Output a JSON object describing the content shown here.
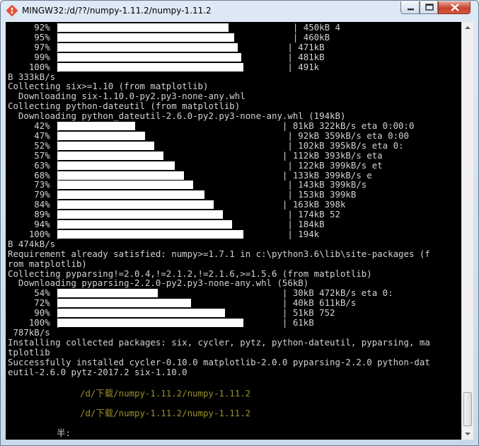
{
  "window": {
    "title": "MINGW32:/d/??/numpy-1.11.2/numpy-1.11.2"
  },
  "terminal": {
    "lines": [
      "     92% |                                            | 450kB 4",
      "     95% |                                            | 460kB",
      "     97% |                                           | 471kB",
      "     99% |                                           | 481kB",
      "    100% |                                           | 491k",
      "B 333kB/s",
      "Collecting six>=1.10 (from matplotlib)",
      "  Downloading six-1.10.0-py2.py3-none-any.whl",
      "Collecting python-dateutil (from matplotlib)",
      "  Downloading python_dateutil-2.6.0-py2.py3-none-any.whl (194kB)",
      "     42% |                                          | 81kB 322kB/s eta 0:00:0",
      "     47% |                                           | 92kB 359kB/s eta 0:00",
      "     52% |                                           | 102kB 395kB/s eta 0:",
      "     57% |                                          | 112kB 393kB/s eta",
      "     63% |                                           | 122kB 399kB/s et",
      "     68% |                                          | 133kB 399kB/s e",
      "     73% |                                           | 143kB 399kB/s",
      "     79% |                                           | 153kB 399kB",
      "     84% |                                          | 163kB 398k",
      "     89% |                                           | 174kB 52",
      "     94% |                                           | 184kB",
      "    100% |                                           | 194k",
      "B 474kB/s",
      "Requirement already satisfied: numpy>=1.7.1 in c:\\python3.6\\lib\\site-packages (f",
      "rom matplotlib)",
      "Collecting pyparsing!=2.0.4,!=2.1.2,!=2.1.6,>=1.5.6 (from matplotlib)",
      "  Downloading pyparsing-2.2.0-py2.py3-none-any.whl (56kB)",
      "     54% |                                          | 30kB 472kB/s eta 0:",
      "     72% |                                          | 40kB 611kB/s",
      "     90% |                                          | 51kB 752",
      "    100% |                                          | 61kB",
      " 787kB/s",
      "Installing collected packages: six, cycler, pytz, python-dateutil, pyparsing, ma",
      "tplotlib",
      "Successfully installed cycler-0.10.0 matplotlib-2.0.0 pyparsing-2.2.0 python-dat",
      "eutil-2.6.0 pytz-2017.2 six-1.10.0"
    ],
    "path_line_1": "/d/下载/numpy-1.11.2/numpy-1.11.2",
    "path_line_2": "/d/下载/numpy-1.11.2/numpy-1.11.2",
    "prompt_line": "半:"
  },
  "progress_bars": [
    {
      "percent": 92
    },
    {
      "percent": 95
    },
    {
      "percent": 97
    },
    {
      "percent": 99
    },
    {
      "percent": 100
    },
    {
      "percent": 42
    },
    {
      "percent": 47
    },
    {
      "percent": 52
    },
    {
      "percent": 57
    },
    {
      "percent": 63
    },
    {
      "percent": 68
    },
    {
      "percent": 73
    },
    {
      "percent": 79
    },
    {
      "percent": 84
    },
    {
      "percent": 89
    },
    {
      "percent": 94
    },
    {
      "percent": 100
    },
    {
      "percent": 54
    },
    {
      "percent": 72
    },
    {
      "percent": 90
    },
    {
      "percent": 100
    }
  ],
  "colors": {
    "terminal_bg": "#000000",
    "terminal_fg": "#d3d3d3",
    "path_text": "#9a8f2c",
    "close_button": "#c5432e"
  },
  "icons": [
    "git-bash-icon",
    "minimize-icon",
    "maximize-icon",
    "close-icon",
    "scroll-up-icon",
    "scroll-down-icon"
  ]
}
